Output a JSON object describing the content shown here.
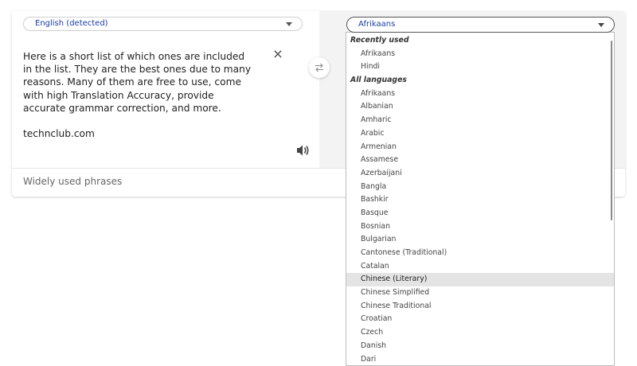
{
  "source": {
    "language_label": "English (detected)",
    "text": "Here is a short list of which ones are included in the list. They are the best ones due to many reasons. Many of them are free to use, come with high Translation Accuracy, provide accurate grammar correction, and more.\n\ntechnclub.com",
    "clear_label": "×"
  },
  "target": {
    "language_label": "Afrikaans"
  },
  "phrases_label": "Widely used phrases",
  "dropdown": {
    "recent_header": "Recently used",
    "recent": [
      "Afrikaans",
      "Hindi"
    ],
    "all_header": "All languages",
    "languages": [
      "Afrikaans",
      "Albanian",
      "Amharic",
      "Arabic",
      "Armenian",
      "Assamese",
      "Azerbaijani",
      "Bangla",
      "Bashkir",
      "Basque",
      "Bosnian",
      "Bulgarian",
      "Cantonese (Traditional)",
      "Catalan",
      "Chinese (Literary)",
      "Chinese Simplified",
      "Chinese Traditional",
      "Croatian",
      "Czech",
      "Danish",
      "Dari"
    ],
    "highlighted": "Chinese (Literary)"
  },
  "icons": {
    "clear": "close-icon",
    "speaker": "speaker-icon",
    "swap": "swap-icon",
    "caret": "chevron-down-icon"
  }
}
